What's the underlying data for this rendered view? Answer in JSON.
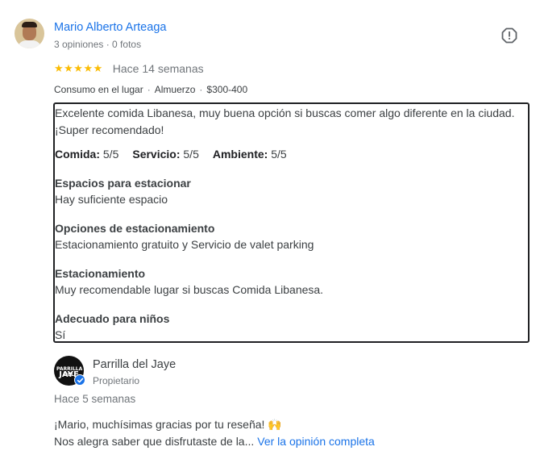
{
  "reviewer": {
    "name": "Mario Alberto Arteaga",
    "meta": "3 opiniones · 0 fotos"
  },
  "review": {
    "stars": "★★★★★",
    "rating": 5,
    "time": "Hace 14 semanas",
    "tags": [
      "Consumo en el lugar",
      "Almuerzo",
      "$300-400"
    ],
    "tag_separator": "·",
    "text_line1": "Excelente comida Libanesa, muy buena opción si buscas comer algo diferente en la ciudad.",
    "text_line2": "¡Super recomendado!",
    "scores": [
      {
        "label": "Comida:",
        "value": "5/5"
      },
      {
        "label": "Servicio:",
        "value": "5/5"
      },
      {
        "label": "Ambiente:",
        "value": "5/5"
      }
    ],
    "attributes": [
      {
        "title": "Espacios para estacionar",
        "value": "Hay suficiente espacio"
      },
      {
        "title": "Opciones de estacionamiento",
        "value": "Estacionamiento gratuito y Servicio de valet parking"
      },
      {
        "title": "Estacionamiento",
        "value": "Muy recomendable lugar si buscas Comida Libanesa."
      },
      {
        "title": "Adecuado para niños",
        "value": "Sí"
      }
    ]
  },
  "owner": {
    "logo_line1": "PARRILLA DEL",
    "logo_line2": "JAYE",
    "name": "Parrilla del Jaye",
    "role": "Propietario",
    "time": "Hace 5 semanas",
    "reply_line1": "¡Mario, muchísimas gracias por tu reseña! 🙌",
    "reply_line2": "Nos alegra saber que disfrutaste de la...",
    "read_more": "Ver la opinión completa"
  },
  "colors": {
    "link": "#1a73e8",
    "star": "#fbbc04",
    "muted": "#70757a",
    "verified": "#1a73e8"
  }
}
